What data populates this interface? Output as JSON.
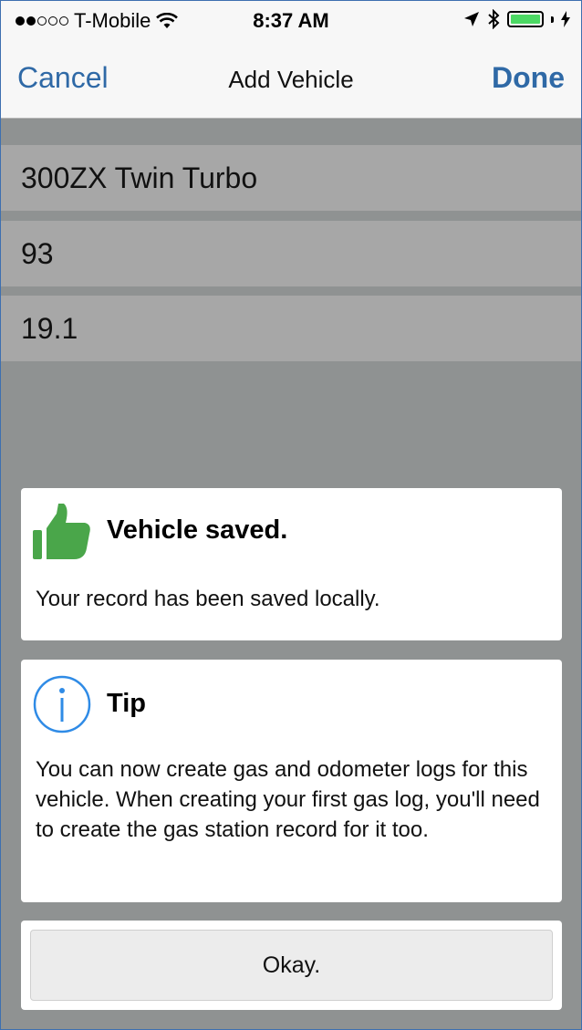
{
  "status_bar": {
    "carrier": "T-Mobile",
    "time": "8:37 AM"
  },
  "nav": {
    "cancel_label": "Cancel",
    "title": "Add Vehicle",
    "done_label": "Done"
  },
  "form": {
    "vehicle_name": "300ZX Twin Turbo",
    "octane": "93",
    "tank_size": "19.1"
  },
  "alert_saved": {
    "icon": "thumbs-up-icon",
    "title": "Vehicle saved.",
    "message": "Your record has been saved locally."
  },
  "alert_tip": {
    "icon": "info-icon",
    "title": "Tip",
    "message": "You can now create gas and odometer logs for this vehicle.  When creating your first gas log, you'll need to create the gas station record for it too."
  },
  "okay_label": "Okay.",
  "colors": {
    "accent": "#2f69a6",
    "success": "#4aa64a",
    "info": "#2f8be6"
  }
}
